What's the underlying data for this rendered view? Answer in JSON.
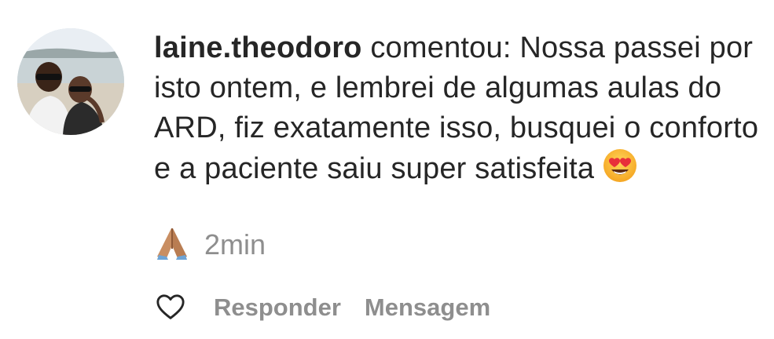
{
  "comment": {
    "username": "laine.theodoro",
    "text": " comentou: Nossa passei por isto ontem, e lembrei de algumas aulas do ARD, fiz exatamente isso, busquei o conforto e a paciente saiu super satisfeita ",
    "emoji_1": "smiling-face-with-heart-eyes",
    "emoji_2": "folded-hands",
    "timestamp": "2min"
  },
  "actions": {
    "like_icon": "heart-outline-icon",
    "reply_label": "Responder",
    "message_label": "Mensagem"
  },
  "colors": {
    "text": "#262626",
    "muted": "#8e8e8e",
    "background": "#ffffff"
  }
}
